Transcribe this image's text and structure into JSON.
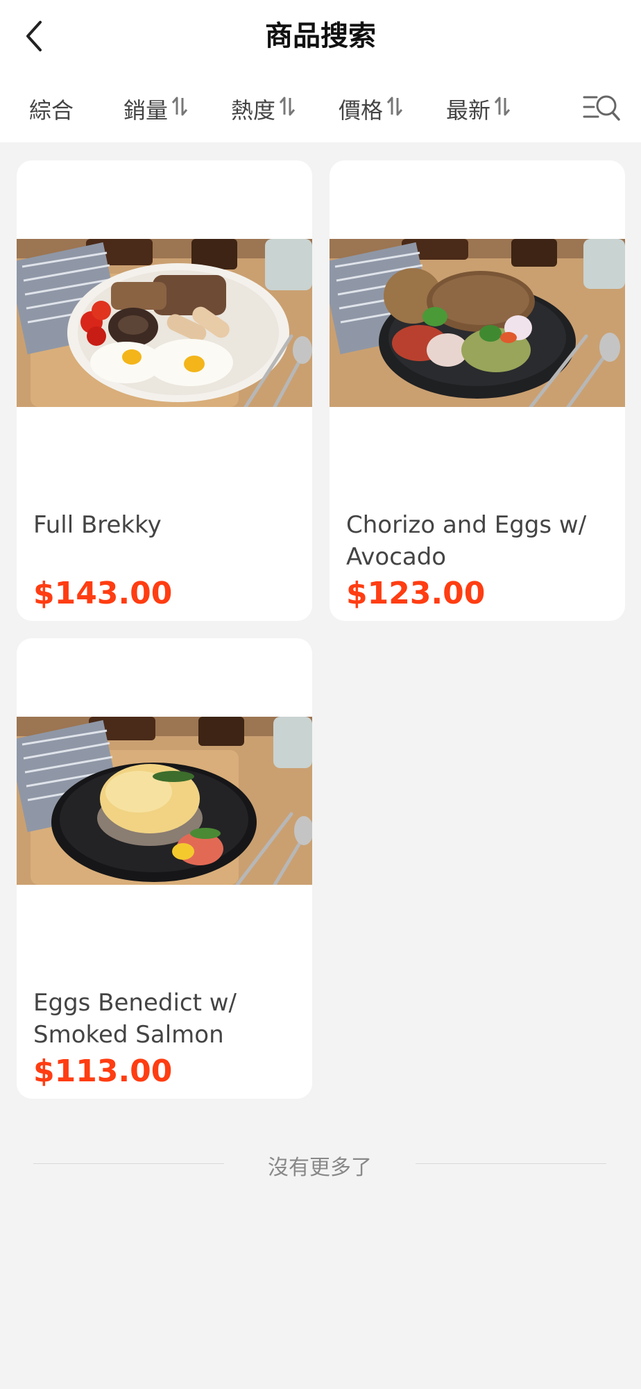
{
  "header": {
    "title": "商品搜索"
  },
  "sort_bar": {
    "items": [
      {
        "label": "綜合",
        "has_arrows": false
      },
      {
        "label": "銷量",
        "has_arrows": true
      },
      {
        "label": "熱度",
        "has_arrows": true
      },
      {
        "label": "價格",
        "has_arrows": true
      },
      {
        "label": "最新",
        "has_arrows": true
      }
    ]
  },
  "products": [
    {
      "name": "Full Brekky",
      "price": "$143.00"
    },
    {
      "name": "Chorizo and Eggs w/ Avocado",
      "price": "$123.00"
    },
    {
      "name": "Eggs Benedict w/ Smoked Salmon",
      "price": "$113.00"
    }
  ],
  "footer": {
    "end_text": "沒有更多了"
  },
  "colors": {
    "price": "#ff3d12",
    "background": "#f3f3f3",
    "card": "#ffffff"
  }
}
